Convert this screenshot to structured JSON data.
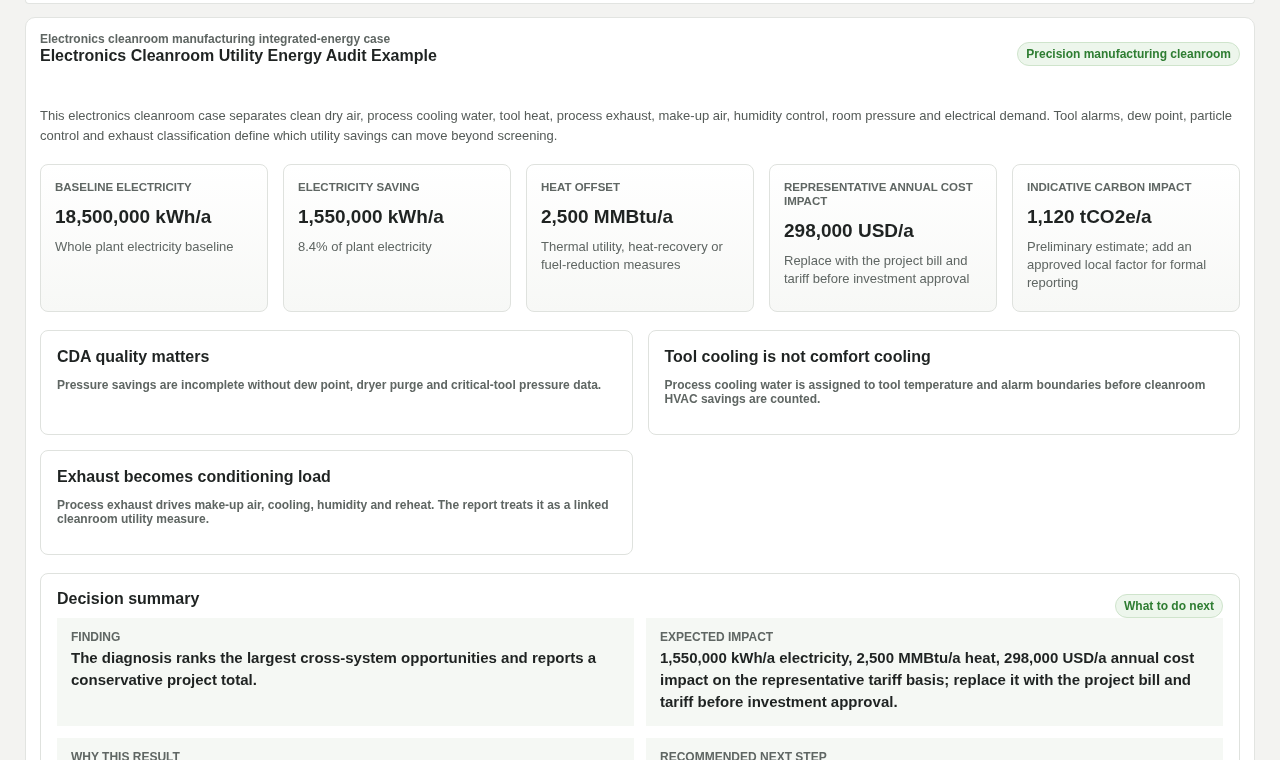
{
  "header": {
    "eyebrow": "Electronics cleanroom manufacturing integrated-energy case",
    "title": "Electronics Cleanroom Utility Energy Audit Example",
    "badge": "Precision manufacturing cleanroom"
  },
  "intro": "This electronics cleanroom case separates clean dry air, process cooling water, tool heat, process exhaust, make-up air, humidity control, room pressure and electrical demand. Tool alarms, dew point, particle control and exhaust classification define which utility savings can move beyond screening.",
  "metrics": [
    {
      "label": "BASELINE ELECTRICITY",
      "value": "18,500,000 kWh/a",
      "note": "Whole plant electricity baseline"
    },
    {
      "label": "ELECTRICITY SAVING",
      "value": "1,550,000 kWh/a",
      "note": "8.4% of plant electricity"
    },
    {
      "label": "HEAT OFFSET",
      "value": "2,500 MMBtu/a",
      "note": "Thermal utility, heat-recovery or fuel-reduction measures"
    },
    {
      "label": "REPRESENTATIVE ANNUAL COST IMPACT",
      "value": "298,000 USD/a",
      "note": "Replace with the project bill and tariff before investment approval"
    },
    {
      "label": "INDICATIVE CARBON IMPACT",
      "value": "1,120 tCO2e/a",
      "note": "Preliminary estimate; add an approved local factor for formal reporting"
    }
  ],
  "insights": [
    {
      "title": "CDA quality matters",
      "text": "Pressure savings are incomplete without dew point, dryer purge and critical-tool pressure data."
    },
    {
      "title": "Tool cooling is not comfort cooling",
      "text": "Process cooling water is assigned to tool temperature and alarm boundaries before cleanroom HVAC savings are counted."
    },
    {
      "title": "Exhaust becomes conditioning load",
      "text": "Process exhaust drives make-up air, cooling, humidity and reheat. The report treats it as a linked cleanroom utility measure."
    }
  ],
  "decision_summary": {
    "title": "Decision summary",
    "badge": "What to do next",
    "items": [
      {
        "label": "FINDING",
        "text": "The diagnosis ranks the largest cross-system opportunities and reports a conservative project total."
      },
      {
        "label": "EXPECTED IMPACT",
        "text": "1,550,000 kWh/a electricity, 2,500 MMBtu/a heat, 298,000 USD/a annual cost impact on the representative tariff basis; replace it with the project bill and tariff before investment approval."
      },
      {
        "label": "WHY THIS RESULT"
      },
      {
        "label": "RECOMMENDED NEXT STEP"
      }
    ]
  }
}
